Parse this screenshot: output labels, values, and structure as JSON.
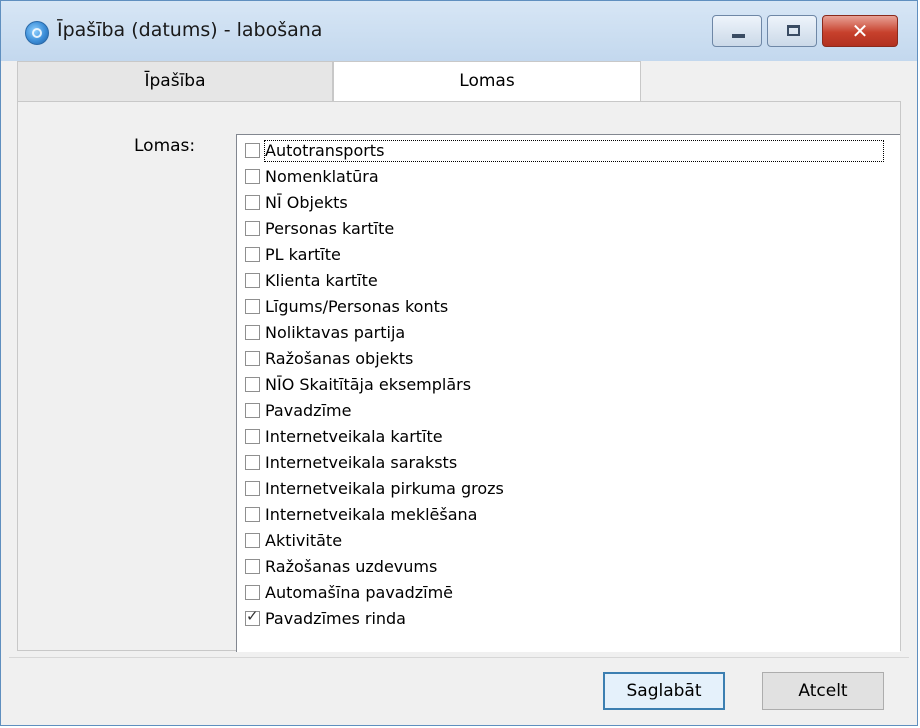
{
  "window": {
    "title": "Īpašība (datums) - labošana",
    "close_glyph": "✕"
  },
  "tabs": [
    {
      "label": "Īpašība",
      "active": false
    },
    {
      "label": "Lomas",
      "active": true
    }
  ],
  "roles_field": {
    "label": "Lomas:",
    "items": [
      {
        "label": "Autotransports",
        "checked": false
      },
      {
        "label": "Nomenklatūra",
        "checked": false
      },
      {
        "label": "NĪ Objekts",
        "checked": false
      },
      {
        "label": "Personas kartīte",
        "checked": false
      },
      {
        "label": "PL kartīte",
        "checked": false
      },
      {
        "label": "Klienta kartīte",
        "checked": false
      },
      {
        "label": "Līgums/Personas konts",
        "checked": false
      },
      {
        "label": "Noliktavas partija",
        "checked": false
      },
      {
        "label": "Ražošanas objekts",
        "checked": false
      },
      {
        "label": "NĪO Skaitītāja eksemplārs",
        "checked": false
      },
      {
        "label": "Pavadzīme",
        "checked": false
      },
      {
        "label": "Internetveikala kartīte",
        "checked": false
      },
      {
        "label": "Internetveikala saraksts",
        "checked": false
      },
      {
        "label": "Internetveikala pirkuma grozs",
        "checked": false
      },
      {
        "label": "Internetveikala meklēšana",
        "checked": false
      },
      {
        "label": "Aktivitāte",
        "checked": false
      },
      {
        "label": "Ražošanas uzdevums",
        "checked": false
      },
      {
        "label": "Automašīna pavadzīmē",
        "checked": false
      },
      {
        "label": "Pavadzīmes rinda",
        "checked": true
      }
    ]
  },
  "buttons": {
    "save": "Saglabāt",
    "cancel": "Atcelt"
  },
  "check_glyph": "✓"
}
